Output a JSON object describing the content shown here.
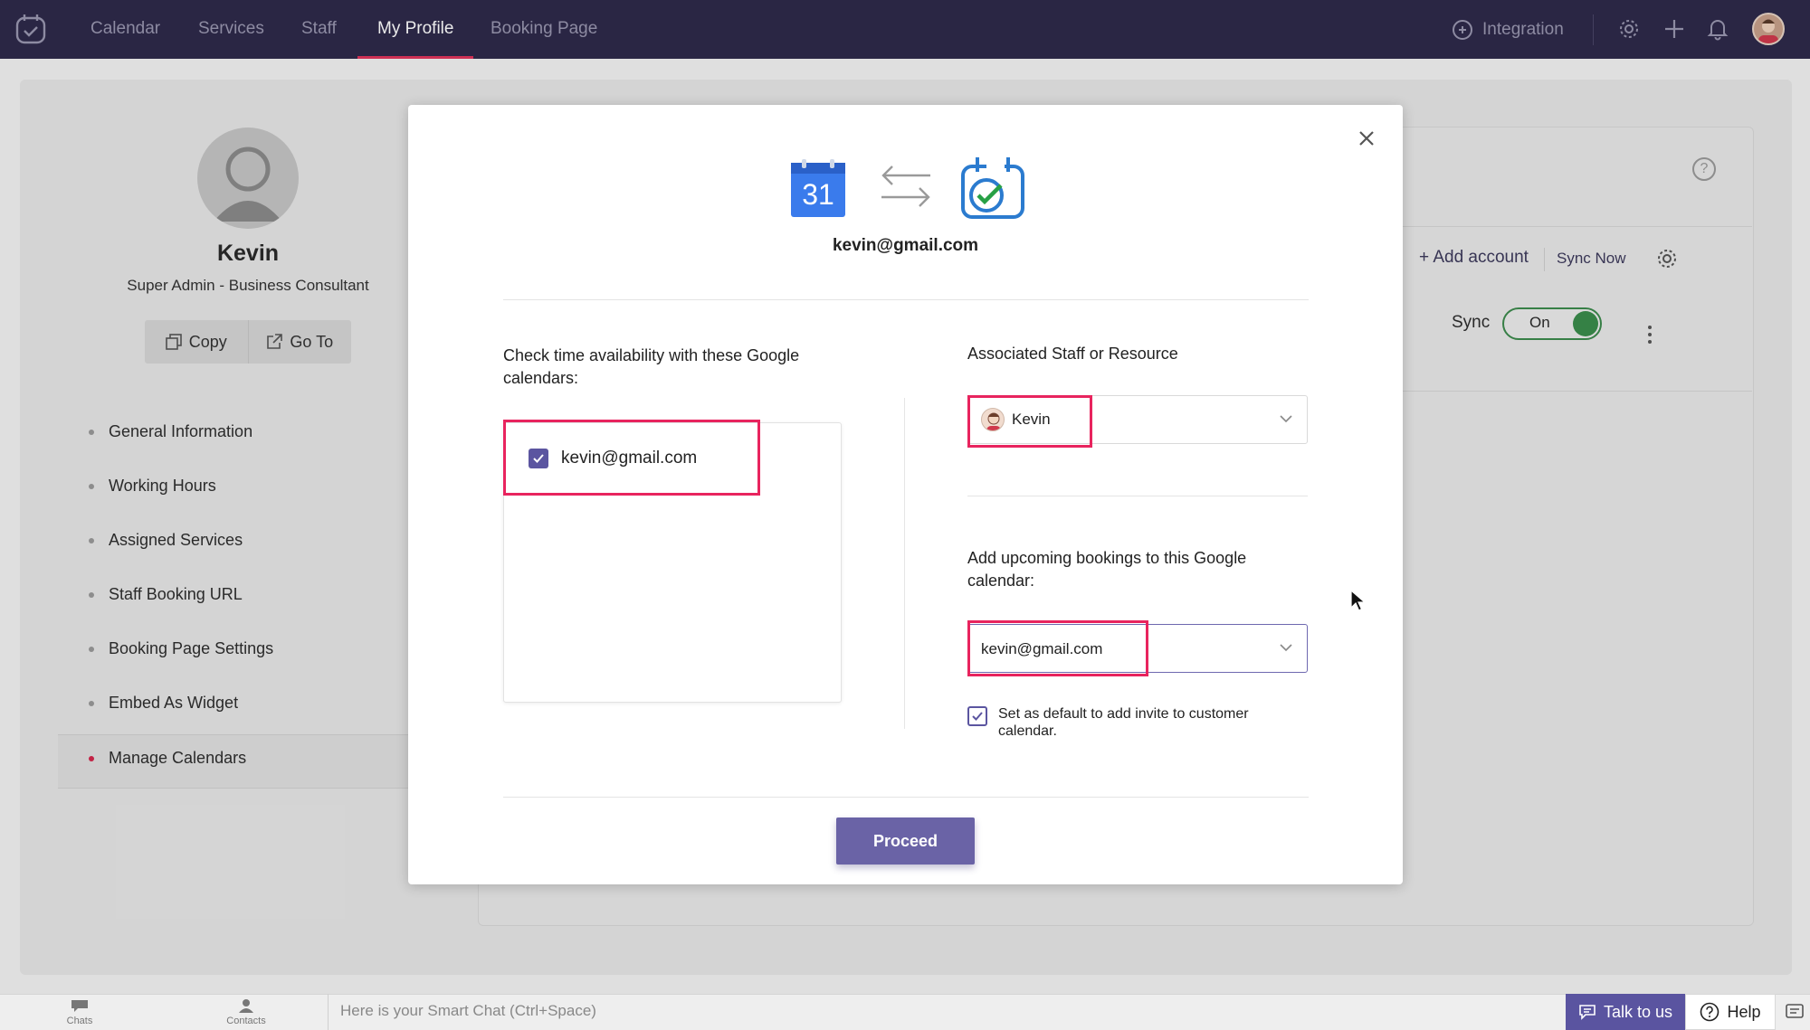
{
  "topnav": {
    "tabs": [
      {
        "label": "Calendar"
      },
      {
        "label": "Services"
      },
      {
        "label": "Staff"
      },
      {
        "label": "My Profile",
        "active": true
      },
      {
        "label": "Booking Page"
      }
    ],
    "integration_label": "Integration"
  },
  "profile": {
    "name": "Kevin",
    "role": "Super Admin - Business Consultant",
    "copy_label": "Copy",
    "goto_label": "Go To"
  },
  "side_menu": {
    "items": [
      {
        "label": "General Information"
      },
      {
        "label": "Working Hours"
      },
      {
        "label": "Assigned Services"
      },
      {
        "label": "Staff Booking URL"
      },
      {
        "label": "Booking Page Settings"
      },
      {
        "label": "Embed As Widget"
      },
      {
        "label": "Manage Calendars",
        "active": true
      }
    ]
  },
  "calendar_panel": {
    "add_account_label": "+ Add account",
    "sync_now_label": "Sync Now",
    "sync_label": "Sync",
    "toggle_label": "On"
  },
  "modal": {
    "gcal_day": "31",
    "account_email": "kevin@gmail.com",
    "availability_label": "Check time availability with these Google calendars:",
    "availability_calendars": [
      {
        "label": "kevin@gmail.com",
        "checked": true
      }
    ],
    "staff_label": "Associated Staff or Resource",
    "staff_selected": "Kevin",
    "upcoming_label": "Add upcoming bookings to this Google calendar:",
    "upcoming_selected": "kevin@gmail.com",
    "default_label": "Set as default to add invite to customer calendar.",
    "default_checked": true,
    "proceed_label": "Proceed"
  },
  "bottombar": {
    "chats_label": "Chats",
    "contacts_label": "Contacts",
    "smart_chat_placeholder": "Here is your Smart Chat (Ctrl+Space)",
    "talk_label": "Talk to us",
    "help_label": "Help"
  },
  "colors": {
    "topbar": "#2e2a4a",
    "accent": "#6a63a6",
    "highlight": "#e8245e",
    "active_tab": "#e0355c",
    "toggle_on": "#3a8d4b"
  }
}
